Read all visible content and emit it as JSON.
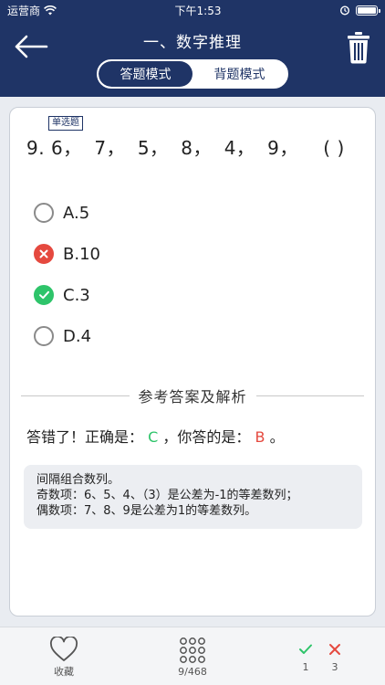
{
  "status_bar": {
    "carrier": "运营商",
    "time": "下午1:53"
  },
  "header": {
    "title": "一、数字推理",
    "back_icon": "arrow-left-icon",
    "delete_icon": "trash-icon"
  },
  "modes": [
    {
      "label": "答题模式",
      "active": true
    },
    {
      "label": "背题模式",
      "active": false
    }
  ],
  "question": {
    "type_badge": "单选题",
    "text": "9. 6，  7，  5，  8，  4，  9，    ( )",
    "options": [
      {
        "label": "A.5",
        "state": "unselected"
      },
      {
        "label": "B.10",
        "state": "wrong"
      },
      {
        "label": "C.3",
        "state": "correct"
      },
      {
        "label": "D.4",
        "state": "unselected"
      }
    ]
  },
  "analysis": {
    "section_title": "参考答案及解析",
    "result_prefix": "答错了！正确是：",
    "correct_answer": "C",
    "result_middle": "，你答的是：",
    "user_answer": "B",
    "result_suffix": "。",
    "explanation": [
      "间隔组合数列。",
      "奇数项：6、5、4、（3）是公差为-1的等差数列；",
      "偶数项：7、8、9是公差为1的等差数列。"
    ]
  },
  "bottom_bar": {
    "favorite_label": "收藏",
    "progress_label": "9/468",
    "right_count": "1",
    "wrong_count": "3"
  },
  "colors": {
    "primary": "#1f3466",
    "correct": "#2ec46a",
    "wrong": "#e5493f"
  }
}
